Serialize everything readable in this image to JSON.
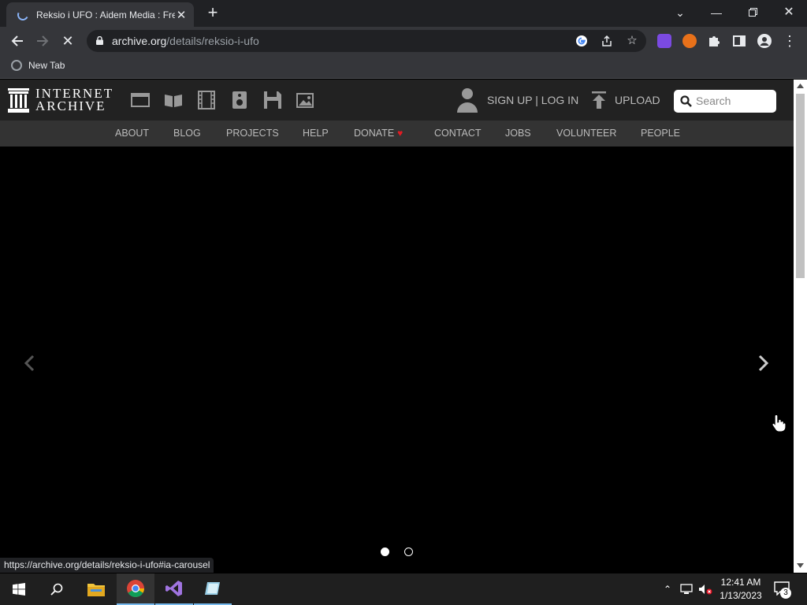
{
  "browser": {
    "tab_title": "Reksio i UFO : Aidem Media : Fre",
    "url_host": "archive.org",
    "url_path": "/details/reksio-i-ufo",
    "bookmark_label": "New Tab",
    "status_url": "https://archive.org/details/reksio-i-ufo#ia-carousel"
  },
  "ia": {
    "logo_line1": "INTERNET",
    "logo_line2": "ARCHIVE",
    "signup_label": "SIGN UP | LOG IN",
    "upload_label": "UPLOAD",
    "search_placeholder": "Search",
    "nav": [
      {
        "label": "ABOUT"
      },
      {
        "label": "BLOG"
      },
      {
        "label": "PROJECTS"
      },
      {
        "label": "HELP"
      },
      {
        "label": "DONATE"
      },
      {
        "label": "CONTACT"
      },
      {
        "label": "JOBS"
      },
      {
        "label": "VOLUNTEER"
      },
      {
        "label": "PEOPLE"
      }
    ],
    "donate_heart": "♥"
  },
  "carousel": {
    "slide_count": 2,
    "active_slide": 1
  },
  "taskbar": {
    "time": "12:41 AM",
    "date": "1/13/2023",
    "notification_count": "3"
  },
  "colors": {
    "chrome_dark": "#202124",
    "chrome_mid": "#35363a",
    "ia_header": "#222222",
    "ia_nav": "#333333",
    "donate_heart": "#e31b23"
  }
}
